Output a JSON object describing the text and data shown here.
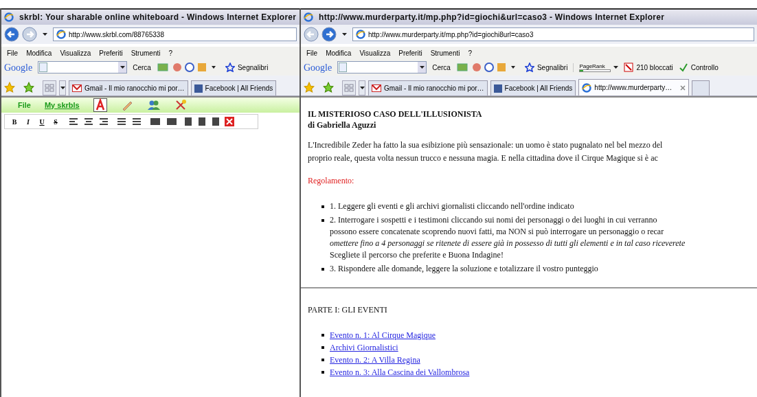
{
  "windows": [
    {
      "title": "skrbl: Your sharable online whiteboard - Windows Internet Explorer",
      "address": "http://www.skrbl.com/88765338",
      "menu": [
        "File",
        "Modifica",
        "Visualizza",
        "Preferiti",
        "Strumenti",
        "?"
      ],
      "google": {
        "logo": "Google",
        "search_button": "Cerca",
        "tools": [
          {
            "kind": "bookmarks",
            "label": "Segnalibri"
          }
        ]
      },
      "tabs": [
        {
          "label": "Gmail - Il mio ranocchio mi por…",
          "kind": "gmail",
          "selected": false
        },
        {
          "label": "Facebook | All Friends",
          "kind": "facebook",
          "selected": false
        }
      ],
      "page": {
        "kind": "skrbl",
        "menu": [
          "File",
          "My skrbls"
        ],
        "format_buttons": [
          "B",
          "I",
          "U",
          "S"
        ]
      }
    },
    {
      "title": "http://www.murderparty.it/mp.php?id=giochi&url=caso3 - Windows Internet Explorer",
      "address": "http://www.murderparty.it/mp.php?id=giochi8url=caso3",
      "menu": [
        "File",
        "Modifica",
        "Visualizza",
        "Preferiti",
        "Strumenti",
        "?"
      ],
      "google": {
        "logo": "Google",
        "search_button": "Cerca",
        "tools": [
          {
            "kind": "bookmarks",
            "label": "Segnalibri"
          },
          {
            "kind": "pagerank",
            "label": "PageRank",
            "level": 0.1
          },
          {
            "kind": "blocked",
            "label": "210 bloccati"
          },
          {
            "kind": "spell",
            "label": "Controllo"
          }
        ]
      },
      "tabs": [
        {
          "label": "Gmail - Il mio ranocchio mi por…",
          "kind": "gmail",
          "selected": false
        },
        {
          "label": "Facebook | All Friends",
          "kind": "facebook",
          "selected": false
        },
        {
          "label": "http://www.murderparty…",
          "kind": "ie",
          "selected": true
        }
      ],
      "page": {
        "kind": "article",
        "title": "IL MISTERIOSO CASO DELL'ILLUSIONISTA",
        "author": "di Gabriella Aguzzi",
        "intro": [
          "L'Incredibile Zeder ha fatto la sua esibizione più sensazionale: un uomo è stato pugnalato nel bel mezzo del",
          "proprio reale, questa volta nessun trucco e nessuna magia. E nella cittadina dove il Cirque Magique si è ac"
        ],
        "rules_heading": "Regolamento:",
        "rules": [
          {
            "lines": [
              "1. Leggere gli eventi e gli archivi giornalisti cliccando nell'ordine indicato"
            ]
          },
          {
            "lines": [
              "2. Interrogare i sospetti e i testimoni cliccando sui nomi dei personaggi o dei luoghi in cui verranno",
              "possono essere concatenate scoprendo nuovi fatti, ma NON si può interrogare un personaggio o recar",
              "*omettere fino a 4 personaggi se ritenete di essere già in possesso di tutti gli elementi e in tal caso riceverete*",
              "Scegliete il percorso che preferite e Buona Indagine!"
            ]
          },
          {
            "lines": [
              "3. Rispondere alle domande, leggere la soluzione e totalizzare il vostro punteggio"
            ]
          }
        ],
        "section": "PARTE I: GLI EVENTI",
        "links": [
          "Evento n. 1: Al Cirque Magique",
          "Archivi Giornalistici",
          "Evento n. 2: A Villa Regina",
          "Evento n. 3: Alla Cascina dei Vallombrosa"
        ]
      }
    }
  ]
}
